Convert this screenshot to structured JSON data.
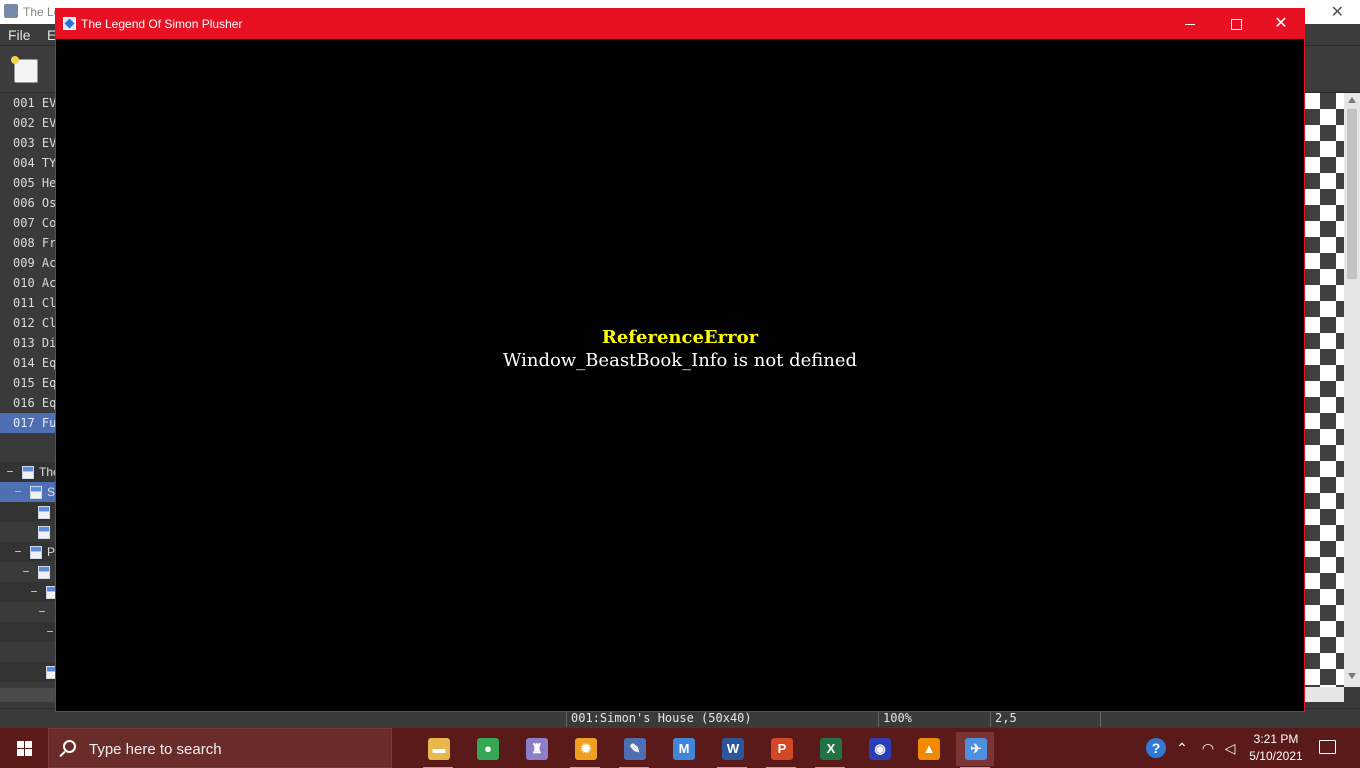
{
  "editor": {
    "title_fragment": "The Le",
    "menu": [
      "File",
      "E"
    ],
    "map_rows": [
      "001 EV",
      "002 EV",
      "003 EV",
      "004 TY",
      "005 He",
      "006 Os",
      "007 Co",
      "008 Fr",
      "009 Ac",
      "010 Ac",
      "011 Cl",
      "012 Cl",
      "013 Di",
      "014 Eq",
      "015 Eq",
      "016 Eq",
      "017 Fu"
    ],
    "selected_map_index": 16,
    "tree": [
      "The",
      "S",
      "",
      "",
      "P"
    ],
    "status": {
      "map": "001:Simon's House (50x40)",
      "zoom": "100%",
      "coords": "2,5"
    }
  },
  "game_window": {
    "title": "The Legend Of Simon Plusher",
    "minimize_icon": "minimize-icon",
    "maximize_icon": "maximize-icon",
    "close_glyph": "✕",
    "error_name": "ReferenceError",
    "error_message": "Window_BeastBook_Info is not defined",
    "accent": "#e81123",
    "error_name_color": "#ffff00"
  },
  "taskbar": {
    "search_placeholder": "Type here to search",
    "apps": [
      {
        "name": "file-explorer",
        "glyph": "▬",
        "color": "#e8b84a"
      },
      {
        "name": "chrome",
        "glyph": "●",
        "color": "#34a853"
      },
      {
        "name": "rpg-maker-2000",
        "glyph": "♜",
        "color": "#8a7fc8"
      },
      {
        "name": "rpg-maker-sun",
        "glyph": "✹",
        "color": "#f0a020"
      },
      {
        "name": "paint-tool",
        "glyph": "✎",
        "color": "#4f6fb5"
      },
      {
        "name": "m-app",
        "glyph": "M",
        "color": "#3f86d9"
      },
      {
        "name": "word",
        "glyph": "W",
        "color": "#2b579a"
      },
      {
        "name": "powerpoint",
        "glyph": "P",
        "color": "#d24726"
      },
      {
        "name": "excel",
        "glyph": "X",
        "color": "#217346"
      },
      {
        "name": "globe-app",
        "glyph": "◉",
        "color": "#2d3fb5"
      },
      {
        "name": "vlc",
        "glyph": "▲",
        "color": "#f08a00"
      },
      {
        "name": "rpg-maker-mv",
        "glyph": "✈",
        "color": "#4f8fe0"
      }
    ],
    "clock_time": "3:21 PM",
    "clock_date": "5/10/2021"
  }
}
